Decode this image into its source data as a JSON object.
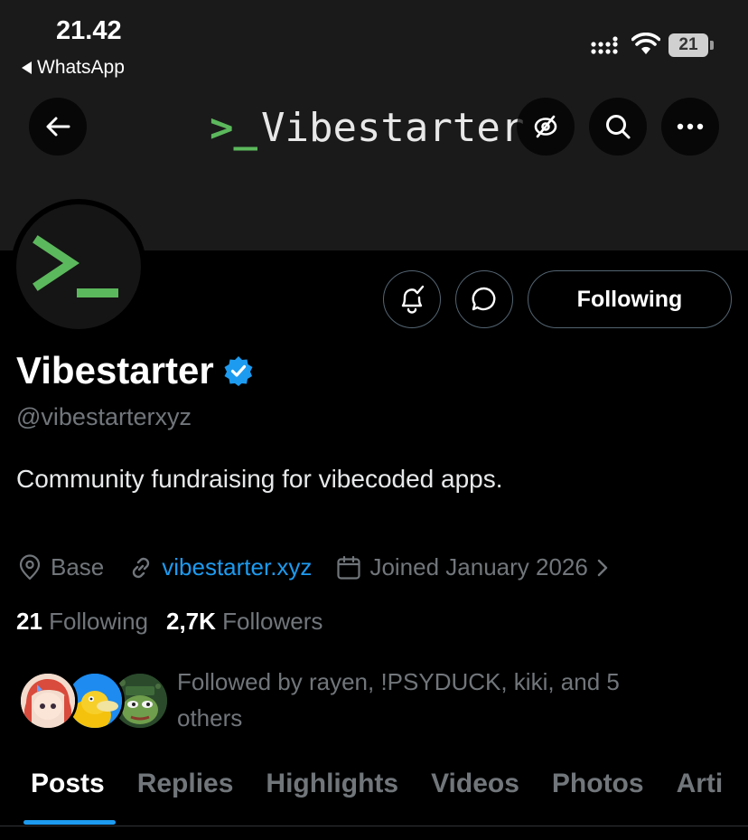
{
  "status_bar": {
    "time": "21.42",
    "back_app": "WhatsApp",
    "battery": "21",
    "signal_icon": "signal-icon",
    "wifi_icon": "wifi-icon"
  },
  "nav": {
    "title_prompt": ">_",
    "title_name": "Vibestarter",
    "back_icon": "arrow-left-icon",
    "hide_icon": "eye-off-icon",
    "search_icon": "search-icon",
    "more_icon": "more-horizontal-icon"
  },
  "profile": {
    "display_name": "Vibestarter",
    "verified": true,
    "handle": "@vibestarterxyz",
    "bio": "Community fundraising for vibecoded apps.",
    "location": "Base",
    "website": "vibestarter.xyz",
    "joined": "Joined January 2026",
    "following_count": "21",
    "following_label": "Following",
    "followers_count": "2,7K",
    "followers_label": "Followers",
    "followed_by": "Followed by rayen, !PSYDUCK, kiki, and 5 others"
  },
  "actions": {
    "following_button": "Following"
  },
  "tabs": [
    "Posts",
    "Replies",
    "Highlights",
    "Videos",
    "Photos",
    "Arti"
  ],
  "colors": {
    "accent": "#1d9bf0",
    "logo_green": "#5cb85c",
    "muted_text": "#71767b",
    "background": "#000000",
    "banner": "#1a1a1a"
  }
}
